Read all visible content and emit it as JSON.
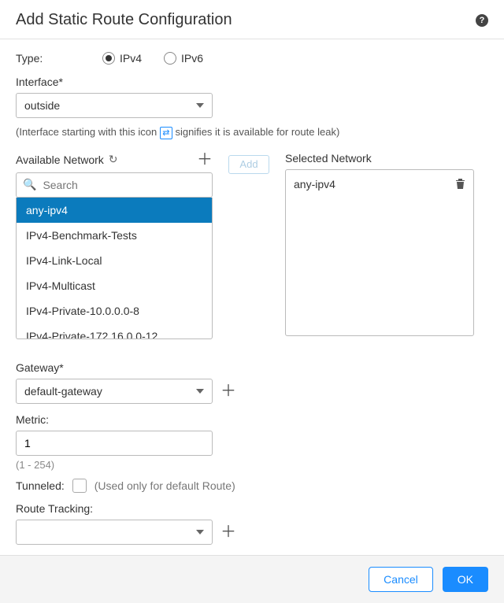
{
  "title": "Add Static Route Configuration",
  "type": {
    "label": "Type:",
    "options": {
      "ipv4": "IPv4",
      "ipv6": "IPv6"
    },
    "selected": "ipv4"
  },
  "interface": {
    "label": "Interface*",
    "value": "outside",
    "hint_prefix": "(Interface starting with this icon",
    "hint_suffix": "signifies it is available for route leak)"
  },
  "available": {
    "label": "Available Network",
    "search_placeholder": "Search",
    "items": [
      "any-ipv4",
      "IPv4-Benchmark-Tests",
      "IPv4-Link-Local",
      "IPv4-Multicast",
      "IPv4-Private-10.0.0.0-8",
      "IPv4-Private-172.16.0.0-12"
    ],
    "selected_index": 0
  },
  "add_button": "Add",
  "selected_network": {
    "label": "Selected Network",
    "items": [
      "any-ipv4"
    ]
  },
  "gateway": {
    "label": "Gateway*",
    "value": "default-gateway"
  },
  "metric": {
    "label": "Metric:",
    "value": "1",
    "range": "(1 - 254)"
  },
  "tunneled": {
    "label": "Tunneled:",
    "hint": "(Used only for default Route)"
  },
  "route_tracking": {
    "label": "Route Tracking:",
    "value": ""
  },
  "footer": {
    "cancel": "Cancel",
    "ok": "OK"
  }
}
